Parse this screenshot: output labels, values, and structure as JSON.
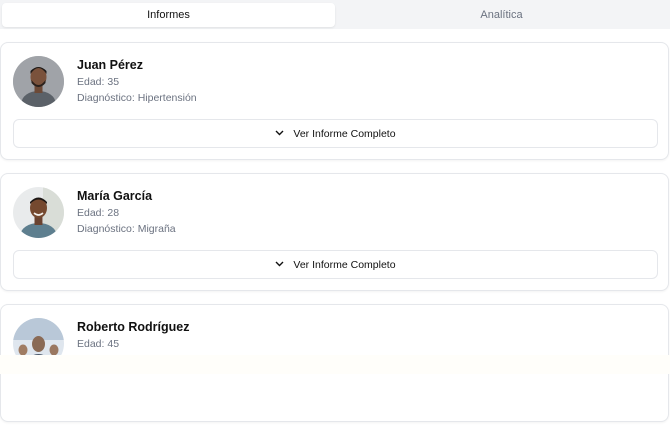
{
  "tabs": [
    {
      "label": "Informes",
      "active": true
    },
    {
      "label": "Analítica",
      "active": false
    }
  ],
  "patients": [
    {
      "name": "Juan Pérez",
      "age": "Edad: 35",
      "diagnosis": "Diagnóstico: Hipertensión",
      "button_label": "Ver Informe Completo",
      "avatar_icon": "man-portrait-photo"
    },
    {
      "name": "María García",
      "age": "Edad: 28",
      "diagnosis": "Diagnóstico: Migraña",
      "button_label": "Ver Informe Completo",
      "avatar_icon": "man-smiling-portrait-photo"
    },
    {
      "name": "Roberto Rodríguez",
      "age": "Edad: 45",
      "diagnosis": "",
      "button_label": "",
      "avatar_icon": "group-photo"
    }
  ],
  "colors": {
    "tab_bar_bg": "#f3f4f6",
    "muted_text": "#6b7280",
    "border": "#e5e7eb"
  }
}
